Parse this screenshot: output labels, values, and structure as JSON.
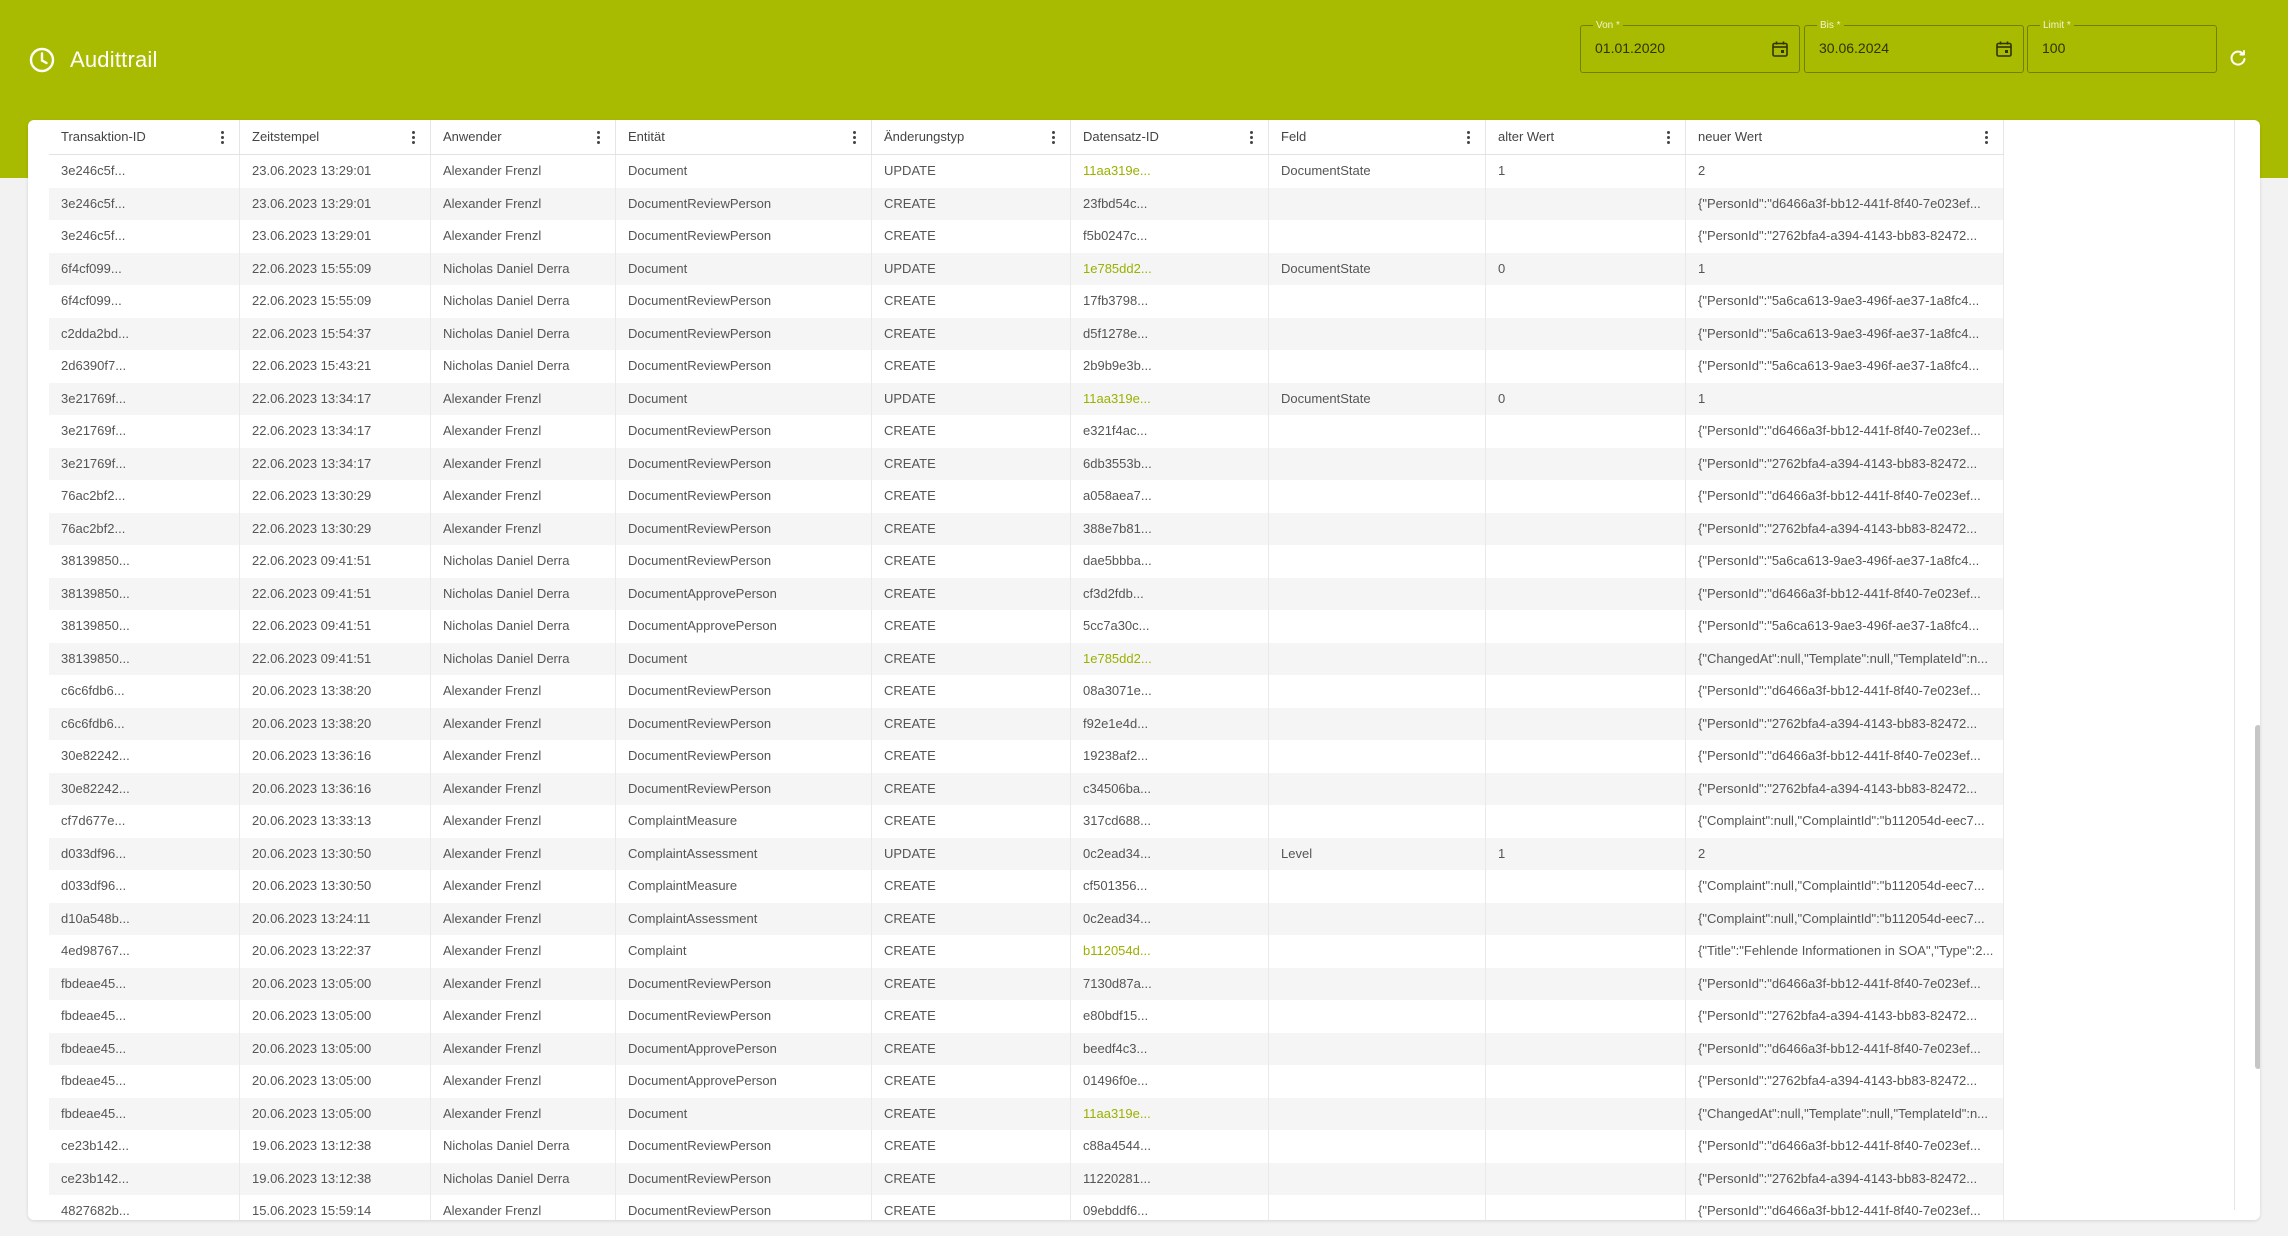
{
  "header": {
    "title": "Audittrail",
    "bg_color": "#a9bb00",
    "von": {
      "label": "Von *",
      "value": "01.01.2020"
    },
    "bis": {
      "label": "Bis *",
      "value": "30.06.2024"
    },
    "limit": {
      "label": "Limit *",
      "value": "100"
    }
  },
  "table": {
    "columns": [
      "Transaktion-ID",
      "Zeitstempel",
      "Anwender",
      "Entität",
      "Änderungstyp",
      "Datensatz-ID",
      "Feld",
      "alter Wert",
      "neuer Wert"
    ],
    "rows": [
      [
        "3e246c5f...",
        "23.06.2023 13:29:01",
        "Alexander Frenzl",
        "Document",
        "UPDATE",
        "11aa319e...",
        "DocumentState",
        "1",
        "2"
      ],
      [
        "3e246c5f...",
        "23.06.2023 13:29:01",
        "Alexander Frenzl",
        "DocumentReviewPerson",
        "CREATE",
        "23fbd54c...",
        "",
        "",
        "{\"PersonId\":\"d6466a3f-bb12-441f-8f40-7e023ef..."
      ],
      [
        "3e246c5f...",
        "23.06.2023 13:29:01",
        "Alexander Frenzl",
        "DocumentReviewPerson",
        "CREATE",
        "f5b0247c...",
        "",
        "",
        "{\"PersonId\":\"2762bfa4-a394-4143-bb83-82472..."
      ],
      [
        "6f4cf099...",
        "22.06.2023 15:55:09",
        "Nicholas Daniel Derra",
        "Document",
        "UPDATE",
        "1e785dd2...",
        "DocumentState",
        "0",
        "1"
      ],
      [
        "6f4cf099...",
        "22.06.2023 15:55:09",
        "Nicholas Daniel Derra",
        "DocumentReviewPerson",
        "CREATE",
        "17fb3798...",
        "",
        "",
        "{\"PersonId\":\"5a6ca613-9ae3-496f-ae37-1a8fc4..."
      ],
      [
        "c2dda2bd...",
        "22.06.2023 15:54:37",
        "Nicholas Daniel Derra",
        "DocumentReviewPerson",
        "CREATE",
        "d5f1278e...",
        "",
        "",
        "{\"PersonId\":\"5a6ca613-9ae3-496f-ae37-1a8fc4..."
      ],
      [
        "2d6390f7...",
        "22.06.2023 15:43:21",
        "Nicholas Daniel Derra",
        "DocumentReviewPerson",
        "CREATE",
        "2b9b9e3b...",
        "",
        "",
        "{\"PersonId\":\"5a6ca613-9ae3-496f-ae37-1a8fc4..."
      ],
      [
        "3e21769f...",
        "22.06.2023 13:34:17",
        "Alexander Frenzl",
        "Document",
        "UPDATE",
        "11aa319e...",
        "DocumentState",
        "0",
        "1"
      ],
      [
        "3e21769f...",
        "22.06.2023 13:34:17",
        "Alexander Frenzl",
        "DocumentReviewPerson",
        "CREATE",
        "e321f4ac...",
        "",
        "",
        "{\"PersonId\":\"d6466a3f-bb12-441f-8f40-7e023ef..."
      ],
      [
        "3e21769f...",
        "22.06.2023 13:34:17",
        "Alexander Frenzl",
        "DocumentReviewPerson",
        "CREATE",
        "6db3553b...",
        "",
        "",
        "{\"PersonId\":\"2762bfa4-a394-4143-bb83-82472..."
      ],
      [
        "76ac2bf2...",
        "22.06.2023 13:30:29",
        "Alexander Frenzl",
        "DocumentReviewPerson",
        "CREATE",
        "a058aea7...",
        "",
        "",
        "{\"PersonId\":\"d6466a3f-bb12-441f-8f40-7e023ef..."
      ],
      [
        "76ac2bf2...",
        "22.06.2023 13:30:29",
        "Alexander Frenzl",
        "DocumentReviewPerson",
        "CREATE",
        "388e7b81...",
        "",
        "",
        "{\"PersonId\":\"2762bfa4-a394-4143-bb83-82472..."
      ],
      [
        "38139850...",
        "22.06.2023 09:41:51",
        "Nicholas Daniel Derra",
        "DocumentReviewPerson",
        "CREATE",
        "dae5bbba...",
        "",
        "",
        "{\"PersonId\":\"5a6ca613-9ae3-496f-ae37-1a8fc4..."
      ],
      [
        "38139850...",
        "22.06.2023 09:41:51",
        "Nicholas Daniel Derra",
        "DocumentApprovePerson",
        "CREATE",
        "cf3d2fdb...",
        "",
        "",
        "{\"PersonId\":\"d6466a3f-bb12-441f-8f40-7e023ef..."
      ],
      [
        "38139850...",
        "22.06.2023 09:41:51",
        "Nicholas Daniel Derra",
        "DocumentApprovePerson",
        "CREATE",
        "5cc7a30c...",
        "",
        "",
        "{\"PersonId\":\"5a6ca613-9ae3-496f-ae37-1a8fc4..."
      ],
      [
        "38139850...",
        "22.06.2023 09:41:51",
        "Nicholas Daniel Derra",
        "Document",
        "CREATE",
        "1e785dd2...",
        "",
        "",
        "{\"ChangedAt\":null,\"Template\":null,\"TemplateId\":n..."
      ],
      [
        "c6c6fdb6...",
        "20.06.2023 13:38:20",
        "Alexander Frenzl",
        "DocumentReviewPerson",
        "CREATE",
        "08a3071e...",
        "",
        "",
        "{\"PersonId\":\"d6466a3f-bb12-441f-8f40-7e023ef..."
      ],
      [
        "c6c6fdb6...",
        "20.06.2023 13:38:20",
        "Alexander Frenzl",
        "DocumentReviewPerson",
        "CREATE",
        "f92e1e4d...",
        "",
        "",
        "{\"PersonId\":\"2762bfa4-a394-4143-bb83-82472..."
      ],
      [
        "30e82242...",
        "20.06.2023 13:36:16",
        "Alexander Frenzl",
        "DocumentReviewPerson",
        "CREATE",
        "19238af2...",
        "",
        "",
        "{\"PersonId\":\"d6466a3f-bb12-441f-8f40-7e023ef..."
      ],
      [
        "30e82242...",
        "20.06.2023 13:36:16",
        "Alexander Frenzl",
        "DocumentReviewPerson",
        "CREATE",
        "c34506ba...",
        "",
        "",
        "{\"PersonId\":\"2762bfa4-a394-4143-bb83-82472..."
      ],
      [
        "cf7d677e...",
        "20.06.2023 13:33:13",
        "Alexander Frenzl",
        "ComplaintMeasure",
        "CREATE",
        "317cd688...",
        "",
        "",
        "{\"Complaint\":null,\"ComplaintId\":\"b112054d-eec7..."
      ],
      [
        "d033df96...",
        "20.06.2023 13:30:50",
        "Alexander Frenzl",
        "ComplaintAssessment",
        "UPDATE",
        "0c2ead34...",
        "Level",
        "1",
        "2"
      ],
      [
        "d033df96...",
        "20.06.2023 13:30:50",
        "Alexander Frenzl",
        "ComplaintMeasure",
        "CREATE",
        "cf501356...",
        "",
        "",
        "{\"Complaint\":null,\"ComplaintId\":\"b112054d-eec7..."
      ],
      [
        "d10a548b...",
        "20.06.2023 13:24:11",
        "Alexander Frenzl",
        "ComplaintAssessment",
        "CREATE",
        "0c2ead34...",
        "",
        "",
        "{\"Complaint\":null,\"ComplaintId\":\"b112054d-eec7..."
      ],
      [
        "4ed98767...",
        "20.06.2023 13:22:37",
        "Alexander Frenzl",
        "Complaint",
        "CREATE",
        "b112054d...",
        "",
        "",
        "{\"Title\":\"Fehlende Informationen in SOA\",\"Type\":2..."
      ],
      [
        "fbdeae45...",
        "20.06.2023 13:05:00",
        "Alexander Frenzl",
        "DocumentReviewPerson",
        "CREATE",
        "7130d87a...",
        "",
        "",
        "{\"PersonId\":\"d6466a3f-bb12-441f-8f40-7e023ef..."
      ],
      [
        "fbdeae45...",
        "20.06.2023 13:05:00",
        "Alexander Frenzl",
        "DocumentReviewPerson",
        "CREATE",
        "e80bdf15...",
        "",
        "",
        "{\"PersonId\":\"2762bfa4-a394-4143-bb83-82472..."
      ],
      [
        "fbdeae45...",
        "20.06.2023 13:05:00",
        "Alexander Frenzl",
        "DocumentApprovePerson",
        "CREATE",
        "beedf4c3...",
        "",
        "",
        "{\"PersonId\":\"d6466a3f-bb12-441f-8f40-7e023ef..."
      ],
      [
        "fbdeae45...",
        "20.06.2023 13:05:00",
        "Alexander Frenzl",
        "DocumentApprovePerson",
        "CREATE",
        "01496f0e...",
        "",
        "",
        "{\"PersonId\":\"2762bfa4-a394-4143-bb83-82472..."
      ],
      [
        "fbdeae45...",
        "20.06.2023 13:05:00",
        "Alexander Frenzl",
        "Document",
        "CREATE",
        "11aa319e...",
        "",
        "",
        "{\"ChangedAt\":null,\"Template\":null,\"TemplateId\":n..."
      ],
      [
        "ce23b142...",
        "19.06.2023 13:12:38",
        "Nicholas Daniel Derra",
        "DocumentReviewPerson",
        "CREATE",
        "c88a4544...",
        "",
        "",
        "{\"PersonId\":\"d6466a3f-bb12-441f-8f40-7e023ef..."
      ],
      [
        "ce23b142...",
        "19.06.2023 13:12:38",
        "Nicholas Daniel Derra",
        "DocumentReviewPerson",
        "CREATE",
        "11220281...",
        "",
        "",
        "{\"PersonId\":\"2762bfa4-a394-4143-bb83-82472..."
      ],
      [
        "4827682b...",
        "15.06.2023 15:59:14",
        "Alexander Frenzl",
        "DocumentReviewPerson",
        "CREATE",
        "09ebddf6...",
        "",
        "",
        "{\"PersonId\":\"d6466a3f-bb12-441f-8f40-7e023ef..."
      ]
    ],
    "link_entities": [
      "Document",
      "Complaint"
    ],
    "link_color": "#9cb000"
  }
}
